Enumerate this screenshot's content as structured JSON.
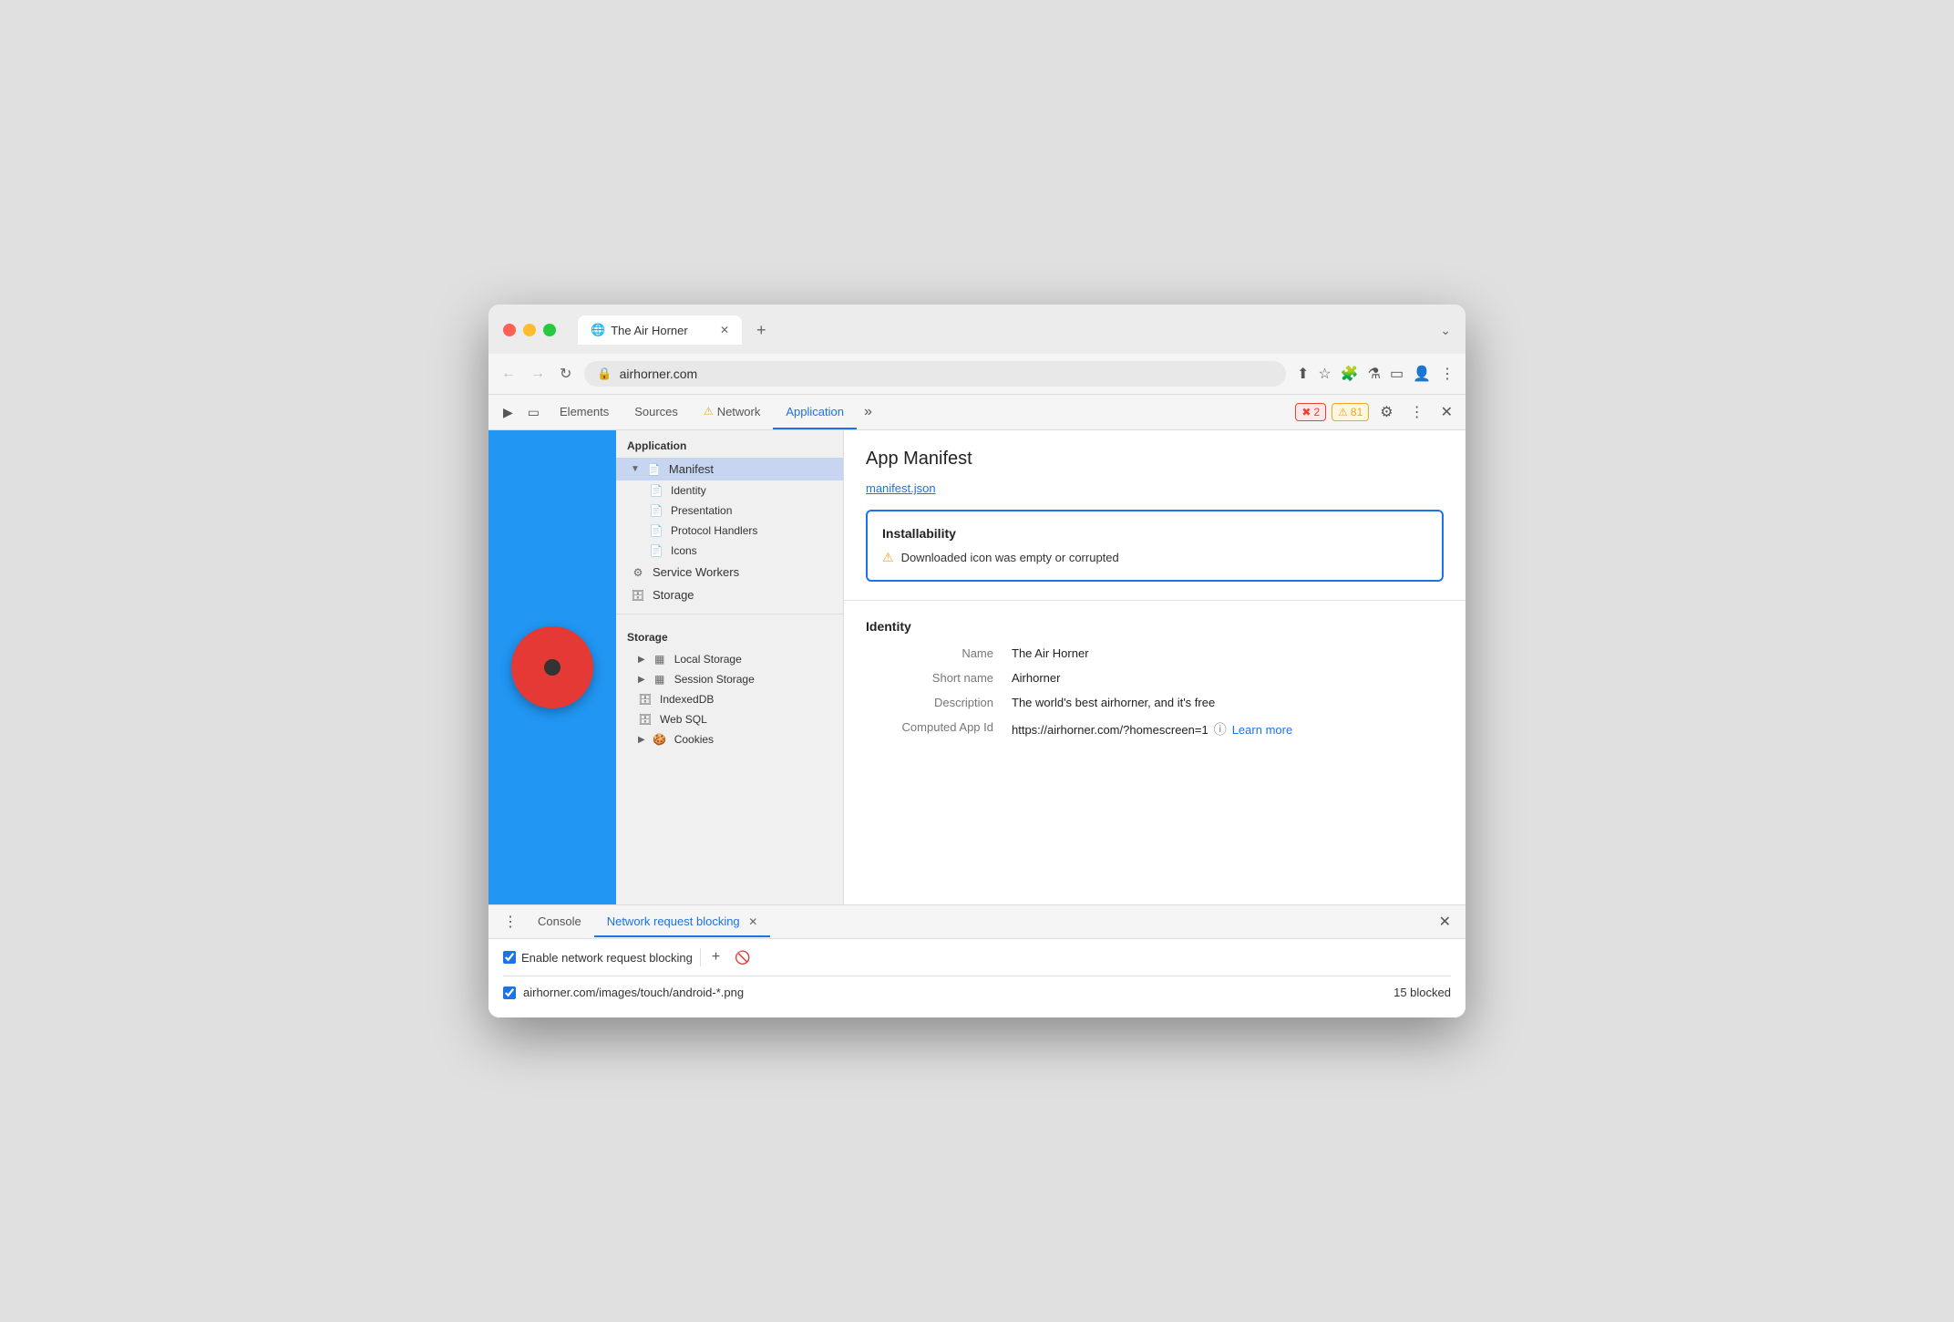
{
  "browser": {
    "tab": {
      "title": "The Air Horner",
      "icon": "🌐",
      "close": "✕"
    },
    "new_tab": "+",
    "chevron": "⌄",
    "url": "airhorner.com",
    "lock_icon": "🔒"
  },
  "devtools": {
    "tabs": [
      {
        "label": "Elements",
        "active": false,
        "warn": false
      },
      {
        "label": "Sources",
        "active": false,
        "warn": false
      },
      {
        "label": "Network",
        "active": false,
        "warn": true
      },
      {
        "label": "Application",
        "active": true,
        "warn": false
      }
    ],
    "more_tabs": "»",
    "error_count": "2",
    "warn_count": "81",
    "settings_icon": "⚙",
    "more_icon": "⋮",
    "close_icon": "✕"
  },
  "sidebar": {
    "application_header": "Application",
    "manifest_item": "Manifest",
    "identity_item": "Identity",
    "presentation_item": "Presentation",
    "protocol_handlers_item": "Protocol Handlers",
    "icons_item": "Icons",
    "service_workers_item": "Service Workers",
    "storage_item": "Storage",
    "storage_header": "Storage",
    "local_storage_item": "Local Storage",
    "session_storage_item": "Session Storage",
    "indexeddb_item": "IndexedDB",
    "web_sql_item": "Web SQL",
    "cookies_item": "Cookies"
  },
  "main": {
    "title": "App Manifest",
    "manifest_link": "manifest.json",
    "installability": {
      "title": "Installability",
      "warning_text": "Downloaded icon was empty or corrupted"
    },
    "identity": {
      "section_title": "Identity",
      "name_label": "Name",
      "name_value": "The Air Horner",
      "short_name_label": "Short name",
      "short_name_value": "Airhorner",
      "description_label": "Description",
      "description_value": "The world's best airhorner, and it's free",
      "computed_app_id_label": "Computed App Id",
      "computed_app_id_value": "https://airhorner.com/?homescreen=1",
      "learn_more": "Learn more"
    }
  },
  "bottom": {
    "dots_icon": "⋮",
    "console_tab": "Console",
    "network_blocking_tab": "Network request blocking",
    "tab_close": "✕",
    "close_all": "✕",
    "enable_blocking_label": "Enable network request blocking",
    "add_icon": "+",
    "block_icon": "🚫",
    "blocked_url": "airhorner.com/images/touch/android-*.png",
    "blocked_count": "15 blocked"
  },
  "app": {
    "background_color": "#2196f3",
    "button_color": "#e53935"
  }
}
